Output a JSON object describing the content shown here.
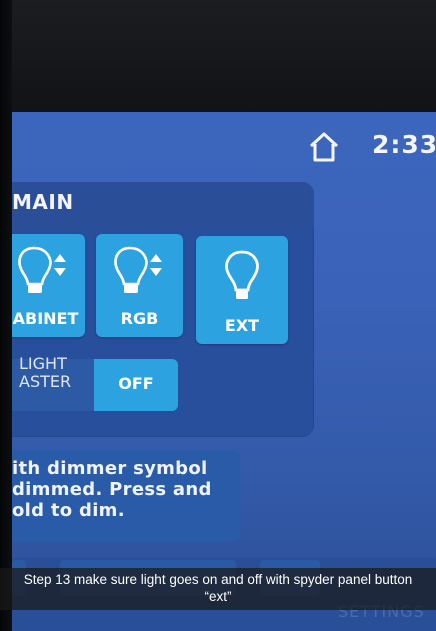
{
  "status_bar": {
    "time": "2:33",
    "home_icon": "home-icon"
  },
  "main_panel": {
    "title": "MAIN",
    "tiles": [
      {
        "label": "ABINET",
        "icon": "bulb-dimmer-icon"
      },
      {
        "label": "RGB",
        "icon": "bulb-dimmer-icon"
      },
      {
        "label": "EXT",
        "icon": "bulb-icon"
      }
    ],
    "light_master": {
      "label_line1": "LIGHT",
      "label_line2": "ASTER",
      "state": "OFF"
    }
  },
  "info": {
    "line1": "ith dimmer symbol",
    "line2": "dimmed. Press and",
    "line3": "old to dim."
  },
  "bottom_bar": {
    "settings_label": "SETTINGS"
  },
  "caption": {
    "text": "Step 13 make sure light goes on and off with spyder panel button “ext”"
  },
  "colors": {
    "screen_blue": "#3a62b8",
    "tile_blue": "#2ca3e0",
    "panel_blue": "#284f9b",
    "text_white": "#ffffff"
  }
}
